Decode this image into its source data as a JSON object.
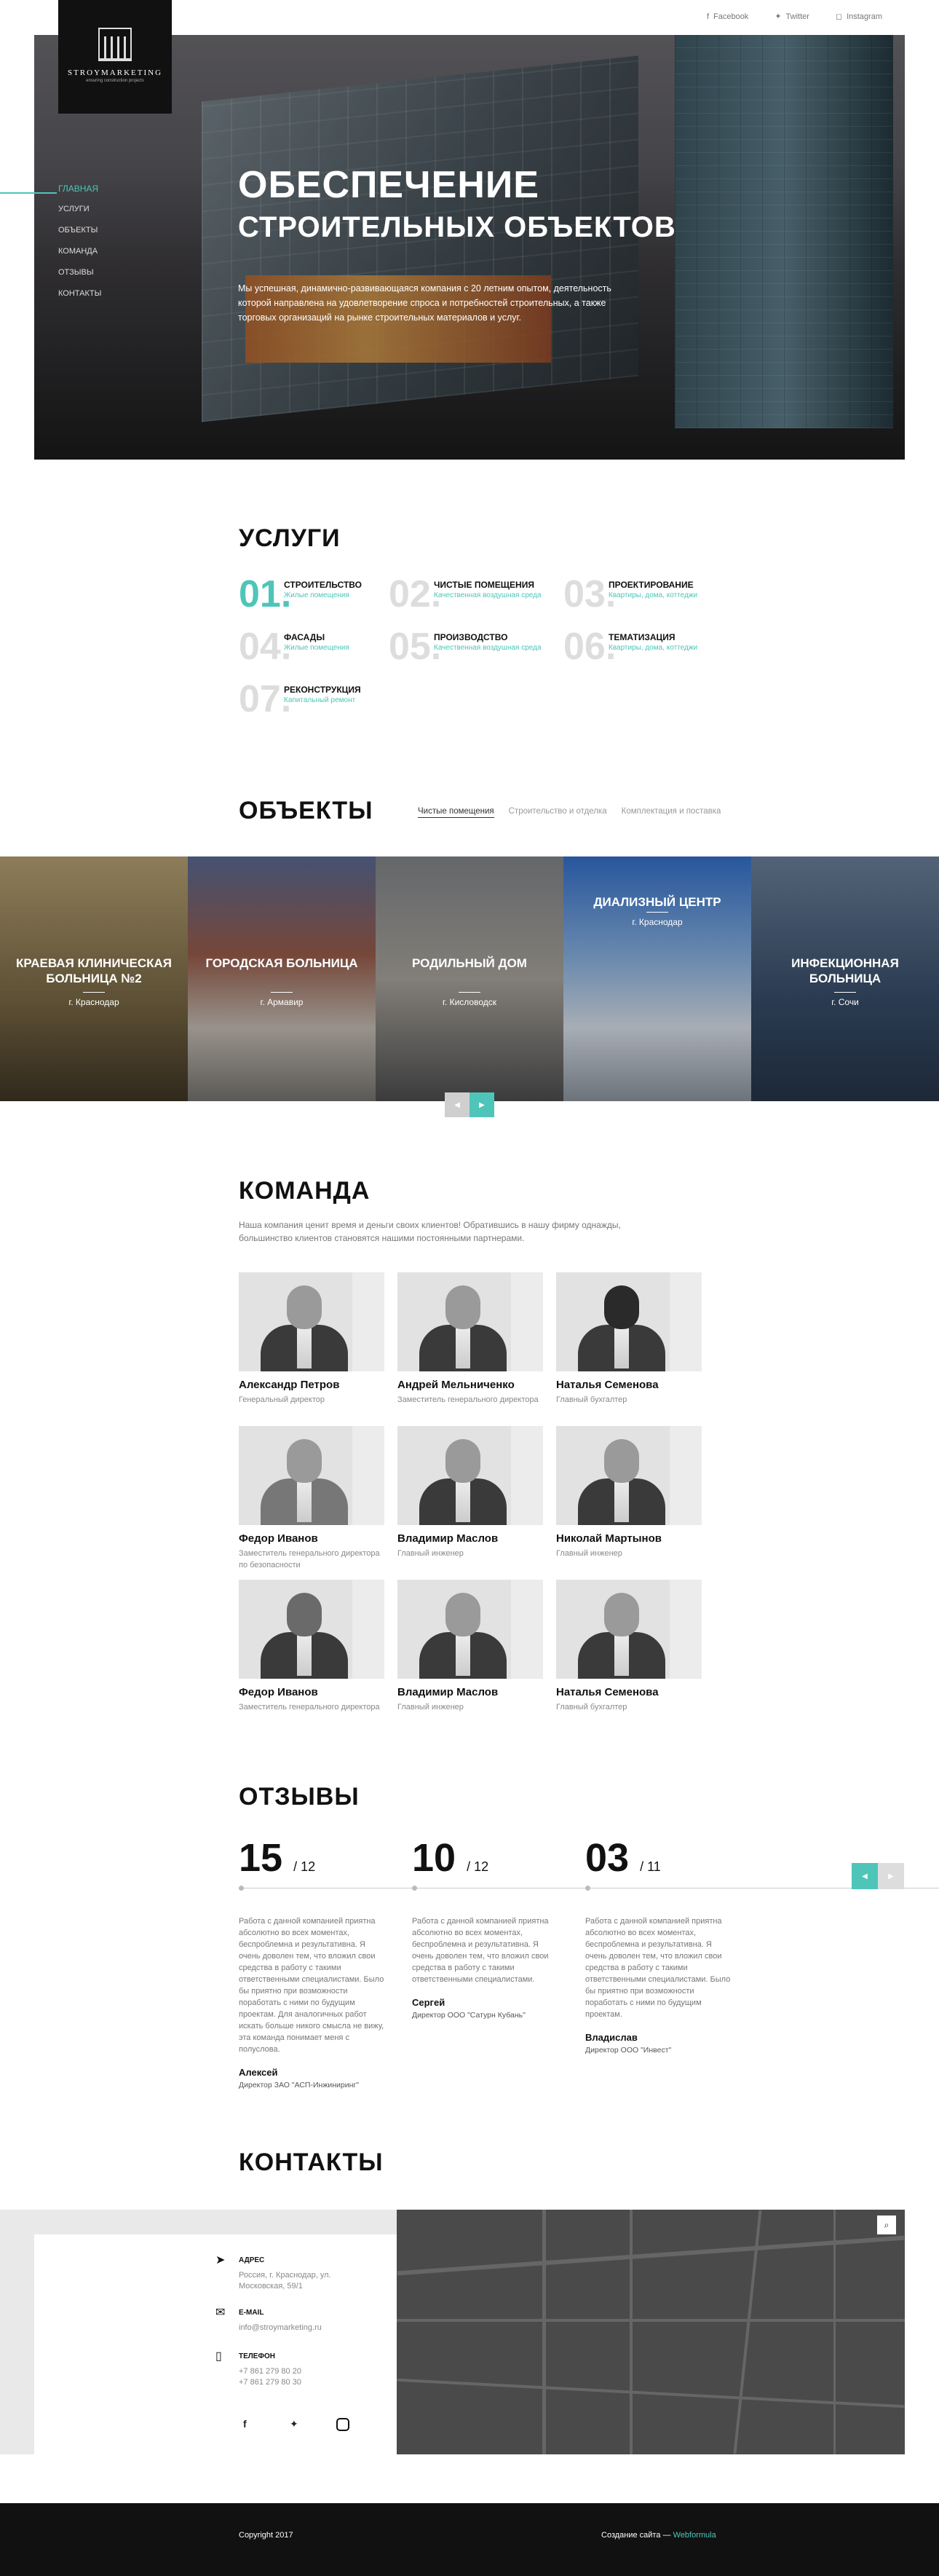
{
  "social": [
    "Facebook",
    "Twitter",
    "Instagram"
  ],
  "logo": {
    "brand": "STROYMARKETING",
    "tagline": "ensuring construction projects"
  },
  "nav": [
    "Главная",
    "Услуги",
    "Объекты",
    "Команда",
    "Отзывы",
    "Контакты"
  ],
  "hero": {
    "title1": "ОБЕСПЕЧЕНИЕ",
    "title2": "СТРОИТЕЛЬНЫХ ОБЪЕКТОВ",
    "text": "Мы успешная, динамично-развивающаяся компания с 20 летним опытом, деятельность которой направлена на удовлетворение спроса и потребностей строительных, а также торговых организаций на рынке строительных материалов и услуг."
  },
  "services_title": "УСЛУГИ",
  "services": [
    {
      "num": "01.",
      "title": "СТРОИТЕЛЬСТВО",
      "sub": "Жилые помещения"
    },
    {
      "num": "02.",
      "title": "ЧИСТЫЕ ПОМЕЩЕНИЯ",
      "sub": "Качественная воздушная среда"
    },
    {
      "num": "03.",
      "title": "ПРОЕКТИРОВАНИЕ",
      "sub": "Квартиры, дома, коттеджи"
    },
    {
      "num": "04.",
      "title": "ФАСАДЫ",
      "sub": "Жилые помещения"
    },
    {
      "num": "05.",
      "title": "ПРОИЗВОДСТВО",
      "sub": "Качественная воздушная среда"
    },
    {
      "num": "06.",
      "title": "ТЕМАТИЗАЦИЯ",
      "sub": "Квартиры, дома, коттеджи"
    },
    {
      "num": "07.",
      "title": "РЕКОНСТРУКЦИЯ",
      "sub": "Капитальный ремонт"
    }
  ],
  "objects_title": "ОБЪЕКТЫ",
  "object_tabs": [
    "Чистые помещения",
    "Строительство и отделка",
    "Комплектация и поставка"
  ],
  "objects": [
    {
      "name": "КРАЕВАЯ КЛИНИЧЕСКАЯ БОЛЬНИЦА №2",
      "city": "г. Краснодар"
    },
    {
      "name": "ГОРОДСКАЯ БОЛЬНИЦА",
      "city": "г. Армавир"
    },
    {
      "name": "РОДИЛЬНЫЙ ДОМ",
      "city": "г. Кисловодск"
    },
    {
      "name": "ДИАЛИЗНЫЙ ЦЕНТР",
      "city": "г. Краснодар"
    },
    {
      "name": "ИНФЕКЦИОННАЯ БОЛЬНИЦА",
      "city": "г. Сочи"
    }
  ],
  "team_title": "КОМАНДА",
  "team_lead": "Наша компания ценит время и деньги своих клиентов! Обратившись в нашу фирму однажды, большинство клиентов становятся нашими постоянными партнерами.",
  "team": [
    {
      "name": "Александр Петров",
      "role": "Генеральный директор"
    },
    {
      "name": "Андрей Мельниченко",
      "role": "Заместитель генерального директора"
    },
    {
      "name": "Наталья Семенова",
      "role": "Главный бухгалтер"
    },
    {
      "name": "Федор Иванов",
      "role": "Заместитель генерального директора по безопасности"
    },
    {
      "name": "Владимир Маслов",
      "role": "Главный инженер"
    },
    {
      "name": "Николай Мартынов",
      "role": "Главный инженер"
    },
    {
      "name": "Федор Иванов",
      "role": "Заместитель генерального директора"
    },
    {
      "name": "Владимир Маслов",
      "role": "Главный инженер"
    },
    {
      "name": "Наталья Семенова",
      "role": "Главный бухгалтер"
    }
  ],
  "reviews_title": "ОТЗЫВЫ",
  "reviews": [
    {
      "day": "15",
      "month": "/ 12",
      "text": "Работа с данной компанией приятна абсолютно во всех моментах, беспроблемна и результативна. Я очень доволен тем, что вложил свои средства в работу с такими ответственными специалистами. Было бы приятно при возможности поработать с ними по будущим проектам. Для аналогичных работ искать больше никого смысла не вижу, эта команда понимает меня с полуслова.",
      "author": "Алексей",
      "pos": "Директор ЗАО \"АСП-Инжиниринг\""
    },
    {
      "day": "10",
      "month": "/ 12",
      "text": "Работа с данной компанией приятна абсолютно во всех моментах, беспроблемна и результативна. Я очень доволен тем, что вложил свои средства в работу с такими ответственными специалистами.",
      "author": "Сергей",
      "pos": "Директор ООО \"Сатурн Кубань\""
    },
    {
      "day": "03",
      "month": "/ 11",
      "text": "Работа с данной компанией приятна абсолютно во всех моментах, беспроблемна и результативна. Я очень доволен тем, что вложил свои средства в работу с такими ответственными специалистами. Было бы приятно при возможности поработать с ними по будущим проектам.",
      "author": "Владислав",
      "pos": "Директор ООО \"Инвест\""
    }
  ],
  "contacts_title": "КОНТАКТЫ",
  "contacts": {
    "address_h": "Адрес",
    "address": "Россия, г. Краснодар, ул. Московская, 59/1",
    "email_h": "E-mail",
    "email": "info@stroymarketing.ru",
    "phone_h": "Телефон",
    "phone1": "+7 861 279 80 20",
    "phone2": "+7 861 279 80 30"
  },
  "footer": {
    "copyright": "Copyright 2017",
    "made_prefix": "Создание сайта —",
    "made_by": "Webformula"
  },
  "accent": "#4ec5b8"
}
